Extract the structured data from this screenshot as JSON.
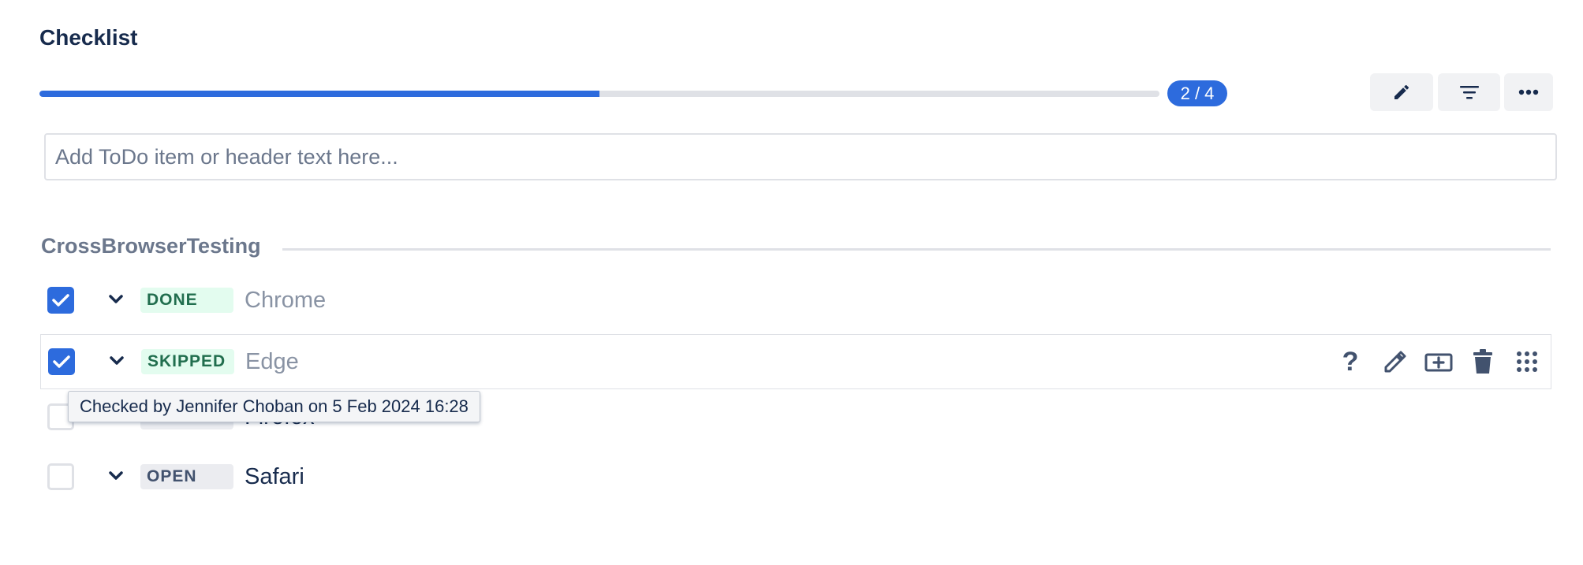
{
  "checklist": {
    "title": "Checklist",
    "progress": {
      "completed": 2,
      "total": 4,
      "label": "2 / 4",
      "fill_fraction": 0.5
    },
    "toolbar": {
      "edit_icon": "pencil-icon",
      "filter_icon": "filter-icon",
      "more_icon": "more-horizontal-icon"
    },
    "add_input": {
      "placeholder": "Add ToDo item or header text here...",
      "value": ""
    },
    "section": {
      "header": "CrossBrowserTesting"
    },
    "items": [
      {
        "checked": true,
        "status": "DONE",
        "text": "Chrome"
      },
      {
        "checked": true,
        "status": "SKIPPED",
        "text": "Edge"
      },
      {
        "checked": false,
        "status": "OPEN",
        "text": "Firefox"
      },
      {
        "checked": false,
        "status": "OPEN",
        "text": "Safari"
      }
    ],
    "hovered_row_actions": [
      "help-icon",
      "pencil-icon",
      "add-item-icon",
      "trash-icon",
      "drag-grid-icon"
    ],
    "tooltip": "Checked by Jennifer Choban on 5 Feb 2024 16:28"
  },
  "colors": {
    "accent": "#2d6bdd",
    "done_bg": "#e3fcef",
    "done_text": "#216e4e",
    "open_bg": "#ebecf0",
    "open_text": "#42526e"
  }
}
